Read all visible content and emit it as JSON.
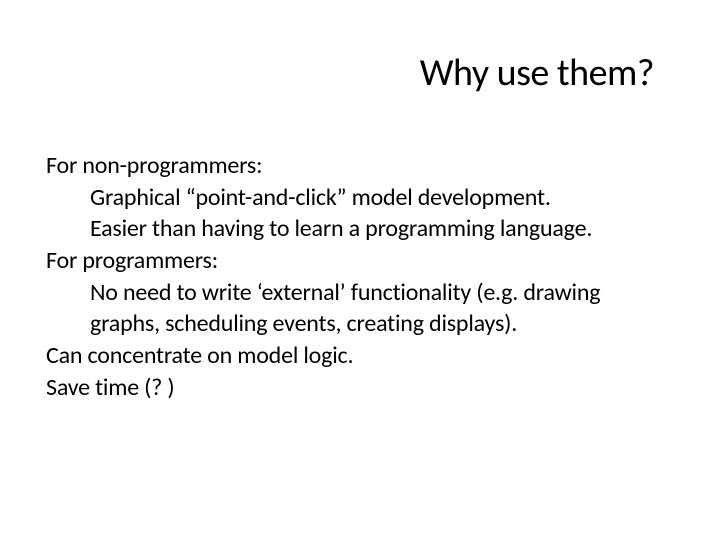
{
  "title": "Why use them?",
  "body": {
    "group1_header": "For non-programmers:",
    "group1_line1": "Graphical “point-and-click” model development.",
    "group1_line2": "Easier than having to learn a programming language.",
    "group2_header": "For programmers:",
    "group2_line1": "No need to write ‘external’ functionality (e.g. drawing",
    "group2_line2": "graphs, scheduling events, creating displays).",
    "line_concentrate": "Can concentrate on model logic.",
    "line_savetime": "Save time (? )"
  }
}
